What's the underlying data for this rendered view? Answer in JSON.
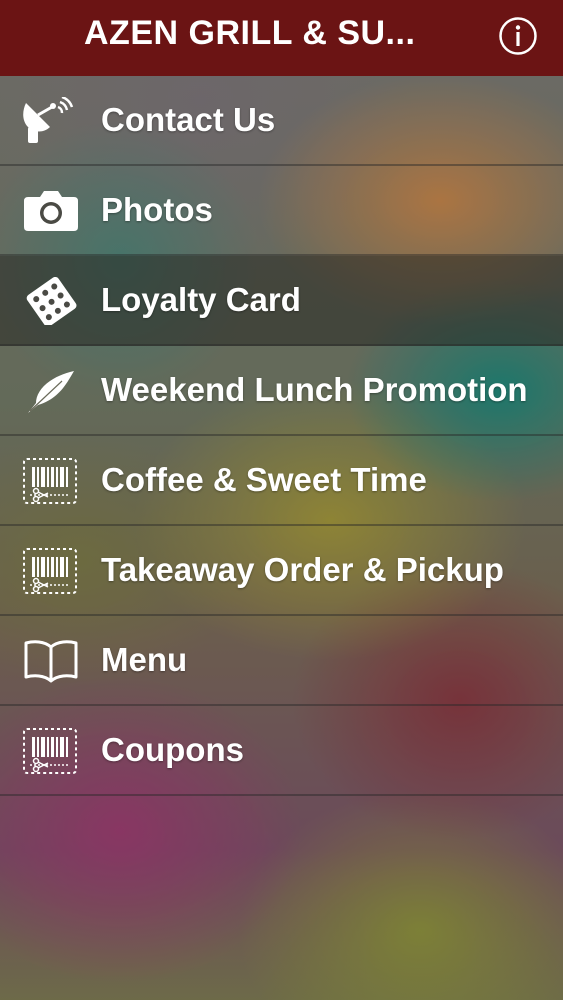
{
  "header": {
    "title": "AZEN GRILL & SU...",
    "info_icon": "info-icon"
  },
  "menu": {
    "items": [
      {
        "label": "Contact Us",
        "icon": "satellite-dish-icon",
        "active": false
      },
      {
        "label": "Photos",
        "icon": "camera-icon",
        "active": false
      },
      {
        "label": "Loyalty Card",
        "icon": "punch-card-icon",
        "active": true
      },
      {
        "label": "Weekend Lunch Promotion",
        "icon": "feather-icon",
        "active": false
      },
      {
        "label": "Coffee & Sweet Time",
        "icon": "coupon-barcode-icon",
        "active": false
      },
      {
        "label": "Takeaway Order & Pickup",
        "icon": "coupon-barcode-icon",
        "active": false
      },
      {
        "label": "Menu",
        "icon": "open-book-icon",
        "active": false
      },
      {
        "label": "Coupons",
        "icon": "coupon-barcode-icon",
        "active": false
      }
    ]
  },
  "colors": {
    "header_bg": "#6b1414",
    "text": "#ffffff",
    "active_row": "#2c2c26"
  }
}
